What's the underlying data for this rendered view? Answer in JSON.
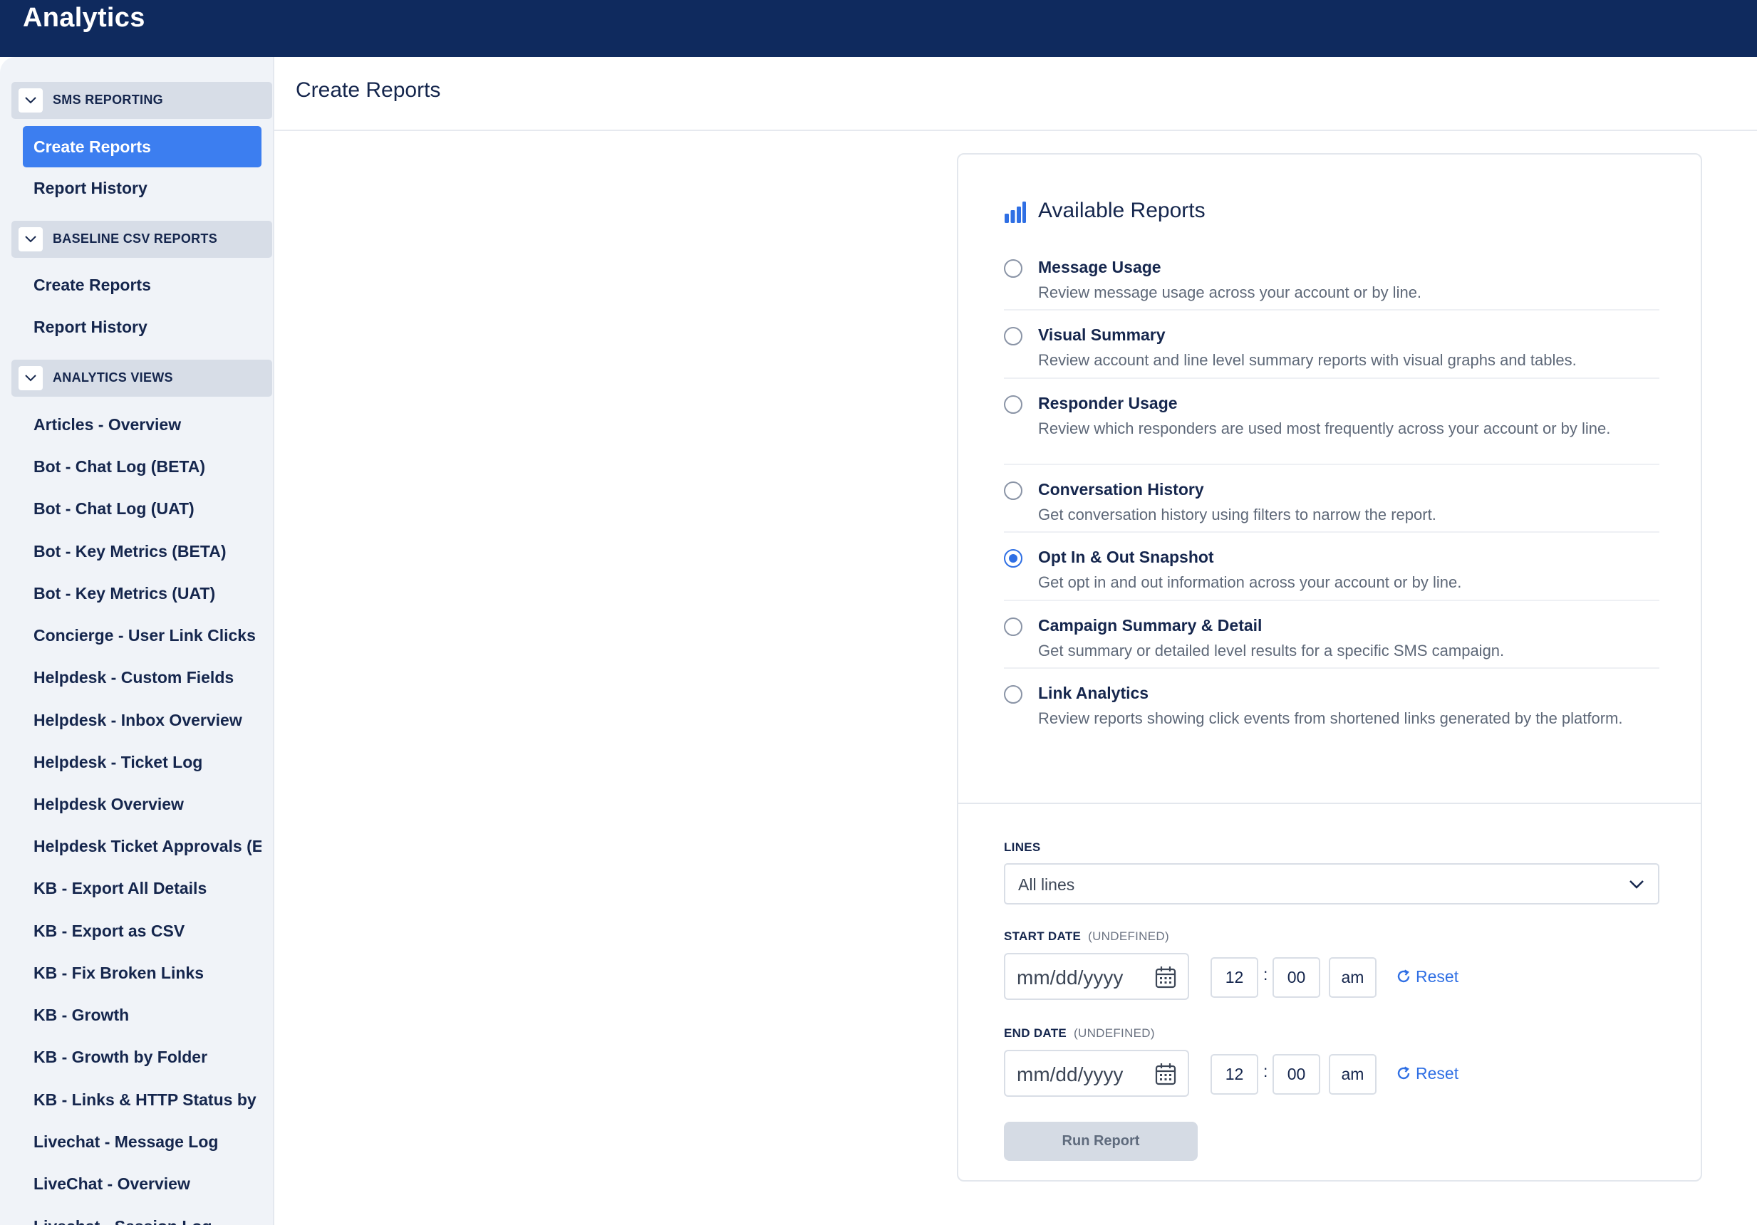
{
  "app": {
    "title": "Analytics"
  },
  "sidebar": {
    "sections": [
      {
        "label": "SMS REPORTING",
        "items": [
          "Create Reports",
          "Report History"
        ],
        "active": "Create Reports"
      },
      {
        "label": "BASELINE CSV REPORTS",
        "items": [
          "Create Reports",
          "Report History"
        ]
      },
      {
        "label": "ANALYTICS VIEWS",
        "items": [
          "Articles - Overview",
          "Bot - Chat Log (BETA)",
          "Bot - Chat Log (UAT)",
          "Bot - Key Metrics (BETA)",
          "Bot - Key Metrics (UAT)",
          "Concierge - User Link Clicks",
          "Helpdesk - Custom Fields",
          "Helpdesk - Inbox Overview",
          "Helpdesk - Ticket Log",
          "Helpdesk Overview",
          "Helpdesk Ticket Approvals (E",
          "KB - Export All Details",
          "KB - Export as CSV",
          "KB - Fix Broken Links",
          "KB - Growth",
          "KB - Growth by Folder",
          "KB - Links & HTTP Status by D",
          "Livechat - Message Log",
          "LiveChat - Overview",
          "Livechat - Session Log"
        ]
      }
    ]
  },
  "main": {
    "page_title": "Create Reports"
  },
  "card": {
    "title": "Available Reports",
    "icon": "bar-chart-icon",
    "accent_color": "#2f6fe4",
    "selected_report": "Opt In & Out Snapshot",
    "reports": [
      {
        "name": "Message Usage",
        "desc": "Review message usage across your account or by line.",
        "checked": false
      },
      {
        "name": "Visual Summary",
        "desc": "Review account and line level summary reports with visual graphs and tables.",
        "checked": false
      },
      {
        "name": "Responder Usage",
        "desc": "Review which responders are used most frequently across your account or by line.",
        "checked": false
      },
      {
        "name": "Conversation History",
        "desc": "Get conversation history using filters to narrow the report.",
        "checked": false
      },
      {
        "name": "Opt In & Out Snapshot",
        "desc": "Get opt in and out information across your account or by line.",
        "checked": true
      },
      {
        "name": "Campaign Summary & Detail",
        "desc": "Get summary or detailed level results for a specific SMS campaign.",
        "checked": false
      },
      {
        "name": "Link Analytics",
        "desc": "Review reports showing click events from shortened links generated by the platform.",
        "checked": false
      }
    ],
    "lines": {
      "label": "LINES",
      "value": "All lines"
    },
    "start_date": {
      "label": "START DATE",
      "sub": "(UNDEFINED)",
      "placeholder": "mm/dd/yyyy",
      "hour": "12",
      "minute": "00",
      "ampm": "am",
      "reset": "Reset"
    },
    "end_date": {
      "label": "END DATE",
      "sub": "(UNDEFINED)",
      "placeholder": "mm/dd/yyyy",
      "hour": "12",
      "minute": "00",
      "ampm": "am",
      "reset": "Reset"
    },
    "run_button": "Run Report"
  }
}
